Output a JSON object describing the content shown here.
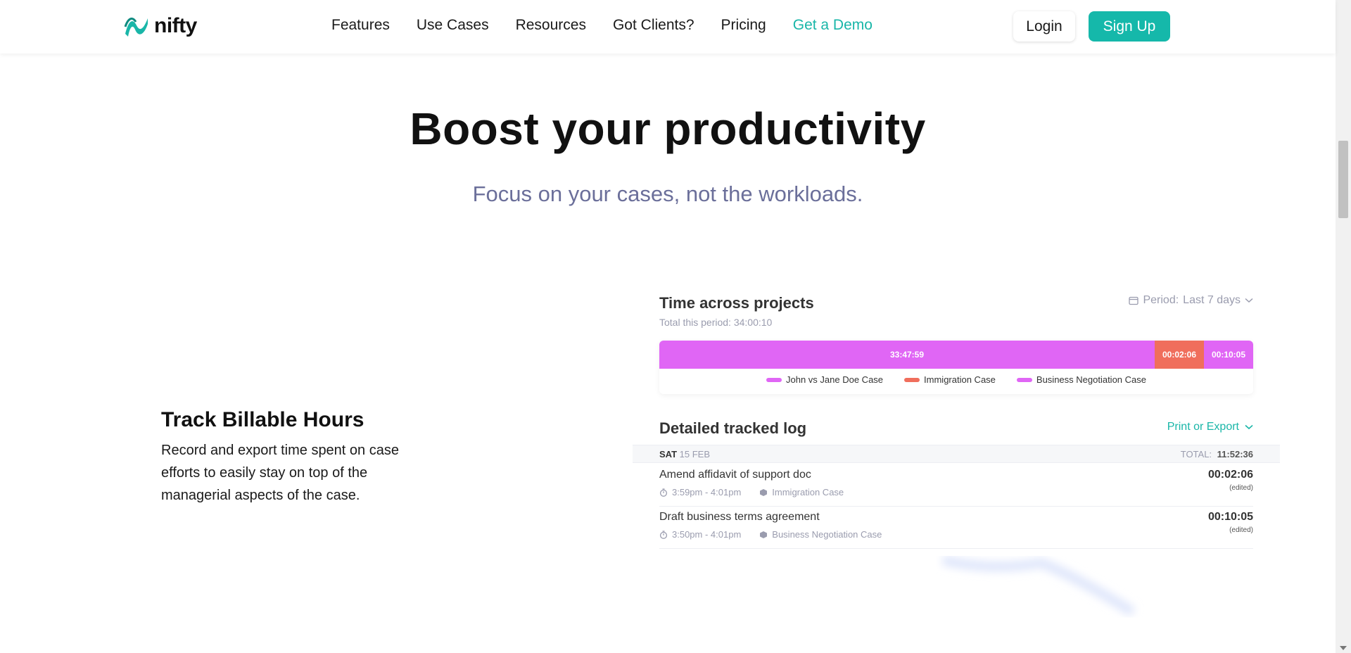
{
  "header": {
    "logo_text": "nifty",
    "nav": [
      {
        "label": "Features"
      },
      {
        "label": "Use Cases"
      },
      {
        "label": "Resources"
      },
      {
        "label": "Got Clients?"
      },
      {
        "label": "Pricing"
      },
      {
        "label": "Get a Demo"
      }
    ],
    "login_label": "Login",
    "signup_label": "Sign Up"
  },
  "hero": {
    "title": "Boost your productivity",
    "subtitle": "Focus on your cases, not the workloads."
  },
  "feature": {
    "title": "Track Billable Hours",
    "description": "Record and export time spent on case efforts to easily stay on top of the managerial aspects of the case."
  },
  "time_card": {
    "title": "Time across projects",
    "period_label": "Period:",
    "period_value": "Last 7 days",
    "total_label": "Total this period: 34:00:10",
    "chart_data": {
      "type": "bar",
      "orientation": "stacked-horizontal",
      "series": [
        {
          "name": "John vs Jane Doe Case",
          "value": "33:47:59",
          "seconds": 121679,
          "color": "#e066f5"
        },
        {
          "name": "Immigration Case",
          "value": "00:02:06",
          "seconds": 126,
          "color": "#f06e5c"
        },
        {
          "name": "Business Negotiation Case",
          "value": "00:10:05",
          "seconds": 605,
          "color": "#e066f5"
        }
      ]
    }
  },
  "log": {
    "title": "Detailed tracked log",
    "export_label": "Print or Export",
    "day": {
      "weekday": "SAT",
      "date": "15 FEB",
      "total_label": "TOTAL:",
      "total_value": "11:52:36"
    },
    "entries": [
      {
        "title": "Amend affidavit of support doc",
        "time": "3:59pm - 4:01pm",
        "project": "Immigration Case",
        "duration": "00:02:06",
        "note": "(edited)"
      },
      {
        "title": "Draft business terms agreement",
        "time": "3:50pm - 4:01pm",
        "project": "Business Negotiation Case",
        "duration": "00:10:05",
        "note": "(edited)"
      }
    ]
  },
  "colors": {
    "brand": "#15b8aa",
    "accent_link": "#19b6a8",
    "subtitle": "#6b6f9a",
    "bar_pink": "#e066f5",
    "bar_orange": "#f06e5c"
  }
}
